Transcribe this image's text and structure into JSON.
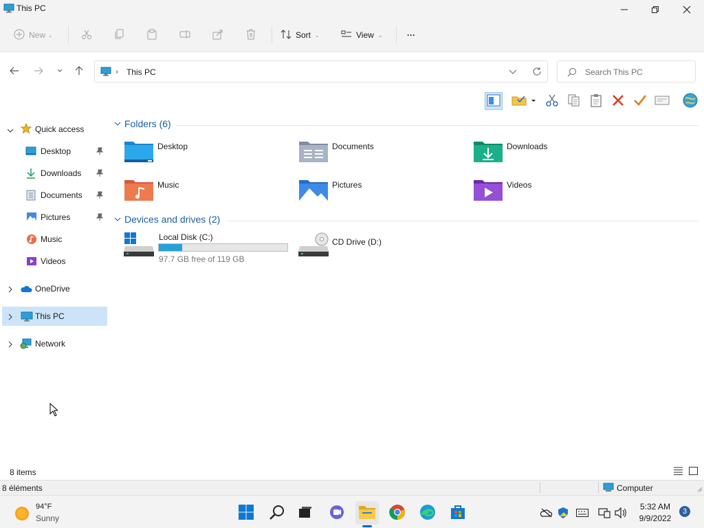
{
  "window": {
    "title": "This PC"
  },
  "toolbar": {
    "new_label": "New",
    "sort_label": "Sort",
    "view_label": "View",
    "more_label": "···"
  },
  "address": {
    "path": "This PC"
  },
  "search": {
    "placeholder": "Search This PC"
  },
  "sidebar": {
    "items": [
      {
        "label": "Quick access"
      },
      {
        "label": "Desktop"
      },
      {
        "label": "Downloads"
      },
      {
        "label": "Documents"
      },
      {
        "label": "Pictures"
      },
      {
        "label": "Music"
      },
      {
        "label": "Videos"
      },
      {
        "label": "OneDrive"
      },
      {
        "label": "This PC"
      },
      {
        "label": "Network"
      }
    ]
  },
  "folders": {
    "header": "Folders (6)",
    "items": [
      {
        "label": "Desktop"
      },
      {
        "label": "Documents"
      },
      {
        "label": "Downloads"
      },
      {
        "label": "Music"
      },
      {
        "label": "Pictures"
      },
      {
        "label": "Videos"
      }
    ]
  },
  "devices": {
    "header": "Devices and drives (2)",
    "items": [
      {
        "label": "Local Disk (C:)",
        "free_text": "97.7 GB free of 119 GB",
        "used_fraction": 0.18
      },
      {
        "label": "CD Drive (D:)"
      }
    ]
  },
  "status": {
    "items_count": "8 items",
    "elements_count": "8 éléments",
    "zone": "Computer"
  },
  "taskbar": {
    "weather_temp": "94°F",
    "weather_desc": "Sunny",
    "time": "5:32 AM",
    "date": "9/9/2022",
    "notification_count": "3"
  },
  "colors": {
    "accent": "#0067c0",
    "selection": "#cce4f7",
    "drive_bar": "#26a0da"
  }
}
